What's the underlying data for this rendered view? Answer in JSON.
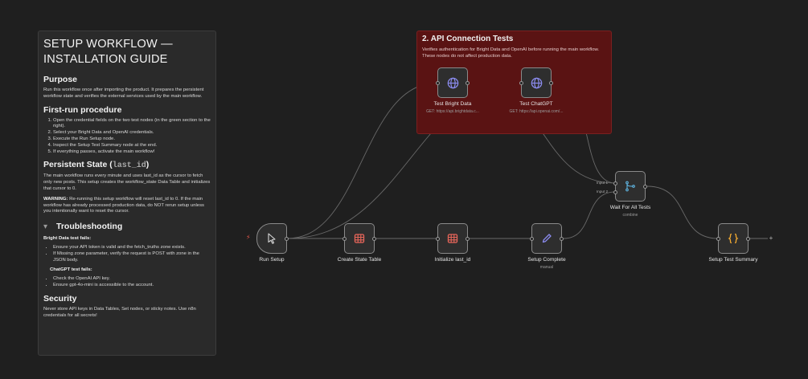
{
  "sticky": {
    "title": "SETUP WORKFLOW — INSTALLATION GUIDE",
    "purpose_heading": "Purpose",
    "purpose_text": "Run this workflow once after importing the product. It prepares the persistent workflow state and verifies the external services used by the main workflow.",
    "firstrun_heading": "First-run procedure",
    "firstrun_steps": [
      "Open the credential fields on the two test nodes (in the green section to the right).",
      "Select your Bright Data and OpenAI credentials.",
      "Execute the Run Setup node.",
      "Inspect the Setup Test Summary node at the end.",
      "If everything passes, activate the main workflow!"
    ],
    "persistent_heading_a": "Persistent State (",
    "persistent_heading_code": "last_id",
    "persistent_heading_b": ")",
    "persistent_p1": "The main workflow runs every minute and uses last_id as the cursor to fetch only new posts. This setup creates the workflow_state Data Table and initializes that cursor to 0.",
    "warning_label": "WARNING:",
    "warning_text": " Re-running this setup workflow will reset last_id to 0. If the main workflow has already processed production data, do NOT rerun setup unless you intentionally want to reset the cursor.",
    "trouble_heading": "Troubleshooting",
    "bright_fails": "Bright Data test fails:",
    "bright_items": [
      "Ensure your API token is valid and the fetch_truths zone exists.",
      "If Missing zone parameter, verify the request is POST with zone in the JSON body."
    ],
    "chatgpt_fails": "ChatGPT test fails:",
    "chatgpt_items": [
      "Check the OpenAI API key.",
      "Ensure gpt-4o-mini is accessible to the account."
    ],
    "security_heading": "Security",
    "security_text": "Never store API keys in Data Tables, Set nodes, or sticky notes. Use n8n credentials for all secrets!"
  },
  "group": {
    "title": "2. API Connection Tests",
    "description": "Verifies authentication for Bright Data and OpenAI before running the main workflow. These nodes do not affect production data."
  },
  "nodes": {
    "run_setup": {
      "label": "Run Setup"
    },
    "create_table": {
      "label": "Create State Table"
    },
    "init_last_id": {
      "label": "Initialize last_id"
    },
    "setup_complete": {
      "label": "Setup Complete",
      "sublabel": "manual"
    },
    "test_bright": {
      "label": "Test Bright Data",
      "sublabel": "GET: https://api.brightdata.c..."
    },
    "test_chatgpt": {
      "label": "Test ChatGPT",
      "sublabel": "GET: https://api.openai.com/..."
    },
    "wait_all": {
      "label": "Wait For All Tests",
      "sublabel": "combine",
      "input1": "Input 1",
      "input2": "Input 2"
    },
    "summary": {
      "label": "Setup Test Summary"
    }
  },
  "colors": {
    "canvas": "#1f1f1f",
    "group_fill": "#5a1313",
    "table_icon": "#e8665a",
    "globe_icon": "#8c8cf0",
    "edit_icon": "#8c8cf0",
    "merge_icon": "#5fb4e0",
    "code_icon": "#f0a830",
    "trigger_bolt": "#e8574a"
  },
  "icons": {
    "run_setup": "cursor-icon",
    "create_table": "table-icon",
    "init_last_id": "table-icon",
    "setup_complete": "pencil-icon",
    "test_bright": "globe-icon",
    "test_chatgpt": "globe-icon",
    "wait_all": "merge-icon",
    "summary": "code-braces-icon"
  }
}
